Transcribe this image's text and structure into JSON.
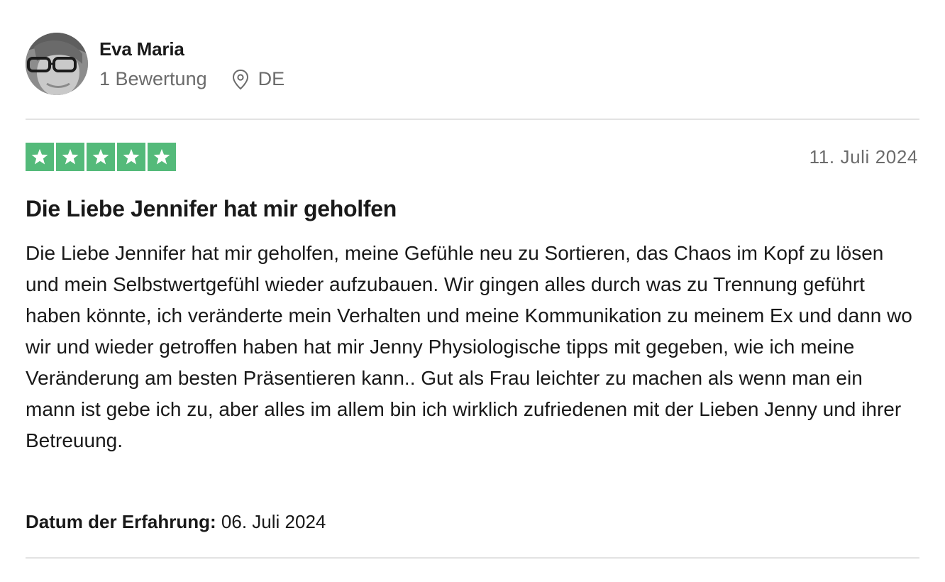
{
  "reviewer": {
    "name": "Eva Maria",
    "review_count": "1 Bewertung",
    "country": "DE",
    "avatar_icon": "user-avatar-photo",
    "location_icon": "location-pin-icon"
  },
  "review": {
    "rating": 5,
    "max_rating": 5,
    "star_color": "#54ba7a",
    "date": "11. Juli 2024",
    "title": "Die Liebe Jennifer hat mir geholfen",
    "body": "Die Liebe Jennifer hat mir geholfen, meine Gefühle neu zu Sortieren, das Chaos im Kopf zu lösen und mein Selbstwertgefühl wieder aufzubauen. Wir gingen alles durch was zu Trennung geführt haben könnte, ich veränderte mein Verhalten und meine Kommunikation zu meinem Ex und dann wo wir und wieder getroffen haben hat mir Jenny Physiologische tipps mit gegeben, wie ich meine Veränderung am besten Präsentieren kann.. Gut als Frau leichter zu machen als wenn man ein mann ist gebe ich zu, aber alles im allem bin ich wirklich zufriedenen mit der Lieben Jenny und ihrer Betreuung.",
    "experience_label": "Datum der Erfahrung:",
    "experience_date": "06. Juli 2024"
  }
}
